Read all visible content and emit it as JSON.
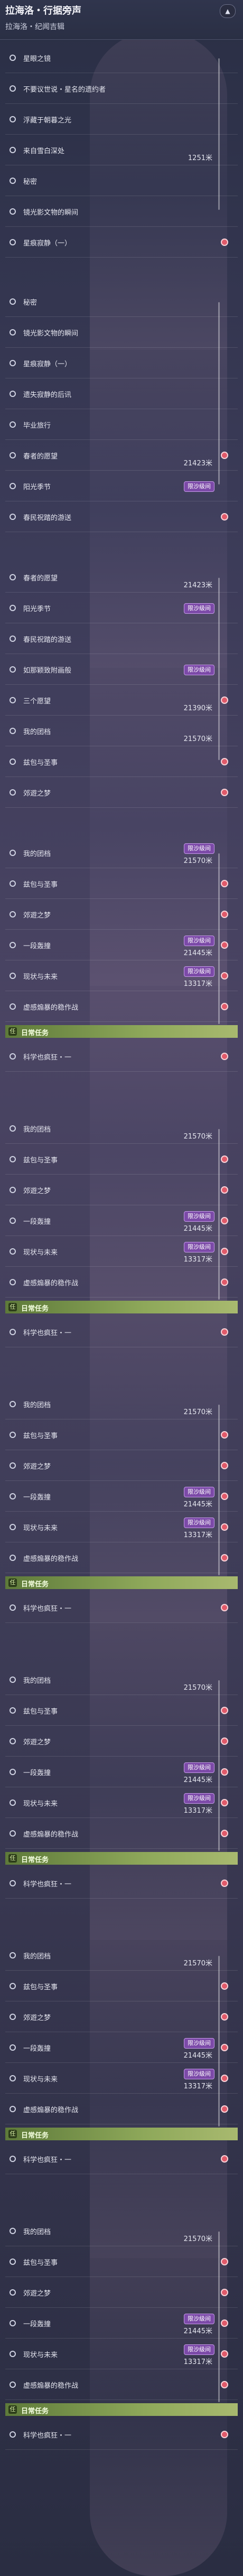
{
  "header": {
    "title": "拉海洛・行据旁声",
    "subtitle": "拉海洛・纪闻吉辑",
    "collapse_icon": "chevron-up-icon"
  },
  "tags": {
    "limit": "限沙级间"
  },
  "daily_label": "日常任务",
  "daily_icon_text": "任",
  "blocks": [
    {
      "rows": [
        {
          "label": "星眼之镜",
          "count": "",
          "dot": false
        },
        {
          "label": "不要议世说・星名的遗约者",
          "count": "",
          "dot": false
        },
        {
          "label": "浮藏于朝暮之光",
          "count": "",
          "dot": false
        },
        {
          "label": "来自雪白深处",
          "count": "1251米",
          "dot": false
        },
        {
          "label": "秘密",
          "count": "",
          "dot": false
        },
        {
          "label": "镜光影文物的瞬间",
          "count": "",
          "dot": false
        },
        {
          "label": "星痕寂静（一）",
          "count": "",
          "dot": true
        }
      ]
    },
    {
      "rows": [
        {
          "label": "秘密",
          "count": "",
          "dot": false
        },
        {
          "label": "镜光影文物的瞬间",
          "count": "",
          "dot": false
        },
        {
          "label": "星痕寂静（一）",
          "count": "",
          "dot": false
        },
        {
          "label": "遗失寂静的后讯",
          "count": "",
          "dot": false
        },
        {
          "label": "毕业旅行",
          "count": "",
          "dot": false
        },
        {
          "label": "春者的愿望",
          "count": "21423米",
          "dot": true
        },
        {
          "label": "阳光季节",
          "count": "",
          "dot": false,
          "tag": true
        },
        {
          "label": "春民祝踏的游送",
          "count": "",
          "dot": true
        }
      ]
    },
    {
      "rows": [
        {
          "label": "春者的愿望",
          "count": "21423米",
          "dot": false
        },
        {
          "label": "阳光季节",
          "count": "",
          "dot": false,
          "tag": true
        },
        {
          "label": "春民祝踏的游送",
          "count": "",
          "dot": false
        },
        {
          "label": "如那颖致附画般",
          "count": "",
          "dot": false,
          "tag": true
        },
        {
          "label": "三个愿望",
          "count": "21390米",
          "dot": true
        },
        {
          "label": "我的团档",
          "count": "21570米",
          "dot": false
        },
        {
          "label": "兹包与圣事",
          "count": "",
          "dot": true
        },
        {
          "label": "郊遊之梦",
          "count": "",
          "dot": true
        }
      ]
    },
    {
      "rows": [
        {
          "label": "我的团档",
          "count": "21570米",
          "dot": false,
          "tag": true
        },
        {
          "label": "兹包与圣事",
          "count": "",
          "dot": true
        },
        {
          "label": "郊遊之梦",
          "count": "",
          "dot": true
        },
        {
          "label": "一段轰撞",
          "count": "21445米",
          "dot": true,
          "tag": true
        },
        {
          "label": "现状与未来",
          "count": "13317米",
          "dot": true,
          "tag": true
        },
        {
          "label": "虚感煽暴的稳作战",
          "count": "",
          "dot": true
        }
      ],
      "daily": true,
      "after": [
        {
          "label": "科学也疯狂・一",
          "count": "",
          "dot": true
        }
      ]
    },
    {
      "rows": [
        {
          "label": "我的团档",
          "count": "21570米",
          "dot": false
        },
        {
          "label": "兹包与圣事",
          "count": "",
          "dot": true
        },
        {
          "label": "郊遊之梦",
          "count": "",
          "dot": true
        },
        {
          "label": "一段轰撞",
          "count": "21445米",
          "dot": true,
          "tag": true
        },
        {
          "label": "现状与未来",
          "count": "13317米",
          "dot": true,
          "tag": true
        },
        {
          "label": "虚感煽暴的稳作战",
          "count": "",
          "dot": true
        }
      ],
      "daily": true,
      "after": [
        {
          "label": "科学也疯狂・一",
          "count": "",
          "dot": true
        }
      ]
    },
    {
      "rows": [
        {
          "label": "我的团档",
          "count": "21570米",
          "dot": false
        },
        {
          "label": "兹包与圣事",
          "count": "",
          "dot": true
        },
        {
          "label": "郊遊之梦",
          "count": "",
          "dot": true
        },
        {
          "label": "一段轰撞",
          "count": "21445米",
          "dot": true,
          "tag": true
        },
        {
          "label": "现状与未来",
          "count": "13317米",
          "dot": true,
          "tag": true
        },
        {
          "label": "虚感煽暴的稳作战",
          "count": "",
          "dot": true
        }
      ],
      "daily": true,
      "after": [
        {
          "label": "科学也疯狂・一",
          "count": "",
          "dot": true
        }
      ]
    },
    {
      "rows": [
        {
          "label": "我的团档",
          "count": "21570米",
          "dot": false
        },
        {
          "label": "兹包与圣事",
          "count": "",
          "dot": true
        },
        {
          "label": "郊遊之梦",
          "count": "",
          "dot": true
        },
        {
          "label": "一段轰撞",
          "count": "21445米",
          "dot": true,
          "tag": true
        },
        {
          "label": "现状与未来",
          "count": "13317米",
          "dot": true,
          "tag": true
        },
        {
          "label": "虚感煽暴的稳作战",
          "count": "",
          "dot": true
        }
      ],
      "daily": true,
      "after": [
        {
          "label": "科学也疯狂・一",
          "count": "",
          "dot": true
        }
      ]
    },
    {
      "rows": [
        {
          "label": "我的团档",
          "count": "21570米",
          "dot": false
        },
        {
          "label": "兹包与圣事",
          "count": "",
          "dot": true
        },
        {
          "label": "郊遊之梦",
          "count": "",
          "dot": true
        },
        {
          "label": "一段轰撞",
          "count": "21445米",
          "dot": true,
          "tag": true
        },
        {
          "label": "现状与未来",
          "count": "13317米",
          "dot": true,
          "tag": true
        },
        {
          "label": "虚感煽暴的稳作战",
          "count": "",
          "dot": true
        }
      ],
      "daily": true,
      "after": [
        {
          "label": "科学也疯狂・一",
          "count": "",
          "dot": true
        }
      ]
    },
    {
      "rows": [
        {
          "label": "我的团档",
          "count": "21570米",
          "dot": false
        },
        {
          "label": "兹包与圣事",
          "count": "",
          "dot": true
        },
        {
          "label": "郊遊之梦",
          "count": "",
          "dot": true
        },
        {
          "label": "一段轰撞",
          "count": "21445米",
          "dot": true,
          "tag": true
        },
        {
          "label": "现状与未来",
          "count": "13317米",
          "dot": true,
          "tag": true
        },
        {
          "label": "虚感煽暴的稳作战",
          "count": "",
          "dot": true
        }
      ],
      "daily": true,
      "after": [
        {
          "label": "科学也疯狂・一",
          "count": "",
          "dot": true
        }
      ]
    }
  ]
}
